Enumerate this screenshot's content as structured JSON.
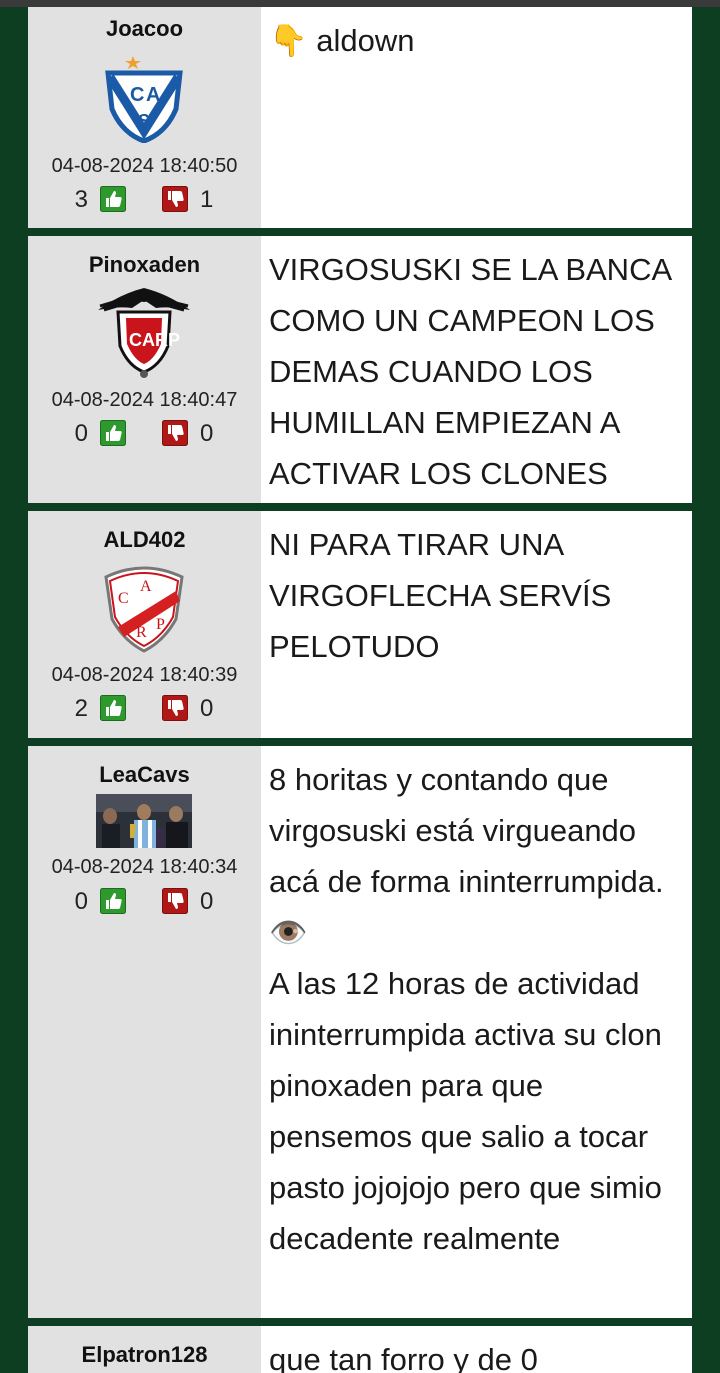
{
  "posts": [
    {
      "username": "Joacoo",
      "avatar": "velez-shield-icon",
      "timestamp": "04-08-2024 18:40:50",
      "likes": "3",
      "dislikes": "1",
      "message": "👇 aldown"
    },
    {
      "username": "Pinoxaden",
      "avatar": "eagle-crest-icon",
      "timestamp": "04-08-2024 18:40:47",
      "likes": "0",
      "dislikes": "0",
      "message": "VIRGOSUSKI SE LA BANCA COMO UN CAMPEON LOS DEMAS CUANDO LOS HUMILLAN EMPIEZAN A ACTIVAR LOS CLONES"
    },
    {
      "username": "ALD402",
      "avatar": "red-sash-shield-icon",
      "timestamp": "04-08-2024 18:40:39",
      "likes": "2",
      "dislikes": "0",
      "message": "NI PARA TIRAR UNA VIRGOFLECHA SERVÍS PELOTUDO"
    },
    {
      "username": "LeaCavs",
      "avatar": "photo-avatar",
      "timestamp": "04-08-2024 18:40:34",
      "likes": "0",
      "dislikes": "0",
      "message": "8 horitas y contando que virgosuski está virgueando acá de forma ininterrumpida. 👁️\nA las 12 horas de actividad ininterrumpida activa su clon pinoxaden para que pensemos que salio a tocar pasto jojojojo pero que simio decadente realmente"
    },
    {
      "username": "Elpatron128",
      "message": "que tan forro y de 0"
    }
  ],
  "colors": {
    "background": "#0d3e22",
    "author_panel": "#e1e1e1",
    "like": "#2e9a2e",
    "dislike": "#b01818"
  }
}
